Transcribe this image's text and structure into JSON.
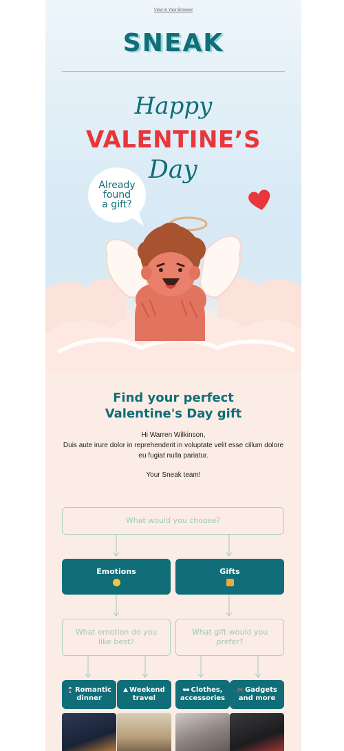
{
  "header": {
    "view_in_browser": "View in Your Browser",
    "logo": "SNEAK"
  },
  "hero": {
    "happy": "Happy",
    "valentines": "VALENTINE’S",
    "day": "Day",
    "bubble": [
      "Already",
      "found",
      "a gift?"
    ]
  },
  "intro": {
    "title_line1": "Find your perfect",
    "title_line2": "Valentine's Day gift",
    "greeting": "Hi Warren Wilkinson,",
    "body": "Duis aute irure dolor in reprehenderit in voluptate velit esse cillum dolore eu fugiat nulla pariatur.",
    "signoff": "Your Sneak team!"
  },
  "quiz": {
    "question": "What would you choose?",
    "options": [
      {
        "label": "Emotions",
        "icon": "heart-eyes-emoji-icon"
      },
      {
        "label": "Gifts",
        "icon": "gift-emoji-icon"
      }
    ],
    "sub_questions": [
      "What emotion do you like best?",
      "What gift would you prefer?"
    ],
    "choices": [
      {
        "label": "Romantic dinner",
        "icon": "wine-glass-icon"
      },
      {
        "label": "Weekend travel",
        "icon": "mountain-icon"
      },
      {
        "label": "Clothes, accessories",
        "icon": "sunglasses-icon"
      },
      {
        "label": "Gadgets and more",
        "icon": "gamepad-icon"
      }
    ]
  },
  "colors": {
    "brand_teal": "#0f6e78",
    "valentine_red": "#e8363c",
    "outline_green": "#a9d2c6"
  }
}
